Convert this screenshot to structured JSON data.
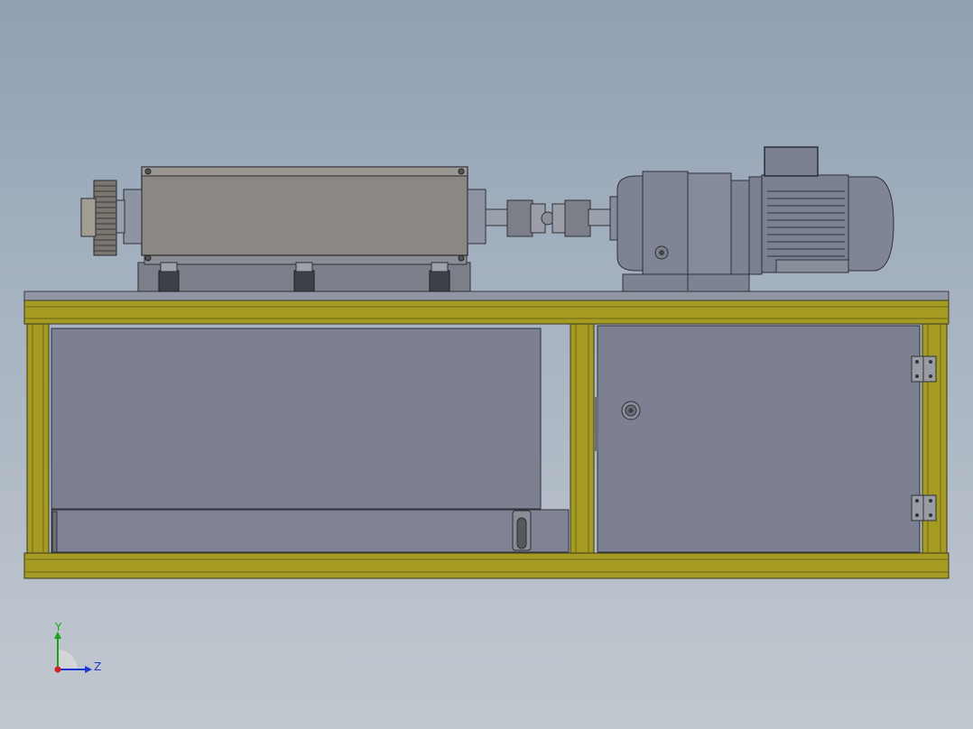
{
  "view": {
    "title": "",
    "triad": {
      "y_label": "Y",
      "z_label": "Z",
      "y_color": "#1aa31a",
      "z_color": "#1a36d4",
      "x_color": "#d42020"
    }
  },
  "colors": {
    "background_top": "#8fa0b3",
    "background_bottom": "#c2c8cf",
    "frame_yellow": "#a59a22",
    "panel_gray": "#7c8090",
    "motor_gray": "#7d8393",
    "housing_gray": "#8b8883"
  },
  "parts": {
    "cabinet_frame": "cabinet-frame",
    "left_panel": "left-panel",
    "right_door": "right-door",
    "gear_housing": "gear-housing",
    "universal_joint": "universal-joint",
    "gear_reducer": "gear-reducer",
    "electric_motor": "electric-motor",
    "spur_gear": "spur-gear"
  }
}
